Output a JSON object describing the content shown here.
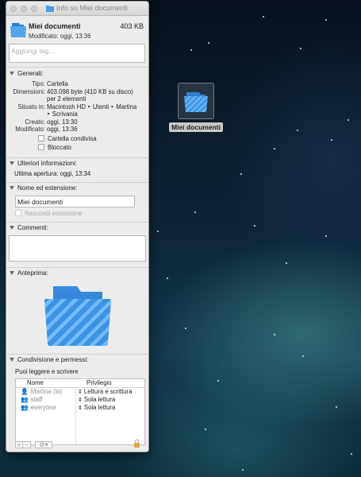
{
  "window": {
    "title": "Info su Miei documenti"
  },
  "header": {
    "name": "Miei documenti",
    "size": "403 KB",
    "modified": "Modificato: oggi, 13:36"
  },
  "tags": {
    "placeholder": "Aggiungi tag…"
  },
  "general": {
    "title": "Generali:",
    "rows": [
      {
        "key": "Tipo:",
        "value": "Cartella"
      },
      {
        "key": "Dimensioni:",
        "value": "403.098 byte (410 KB su disco)"
      },
      {
        "key": "",
        "value": "per 2 elementi"
      },
      {
        "key": "Situato in:",
        "value": "Macintosh HD ‣ Utenti ‣ Martina"
      },
      {
        "key": "",
        "value": "‣ Scrivania"
      },
      {
        "key": "Creato:",
        "value": "oggi, 13:30"
      },
      {
        "key": "Modificato:",
        "value": "oggi, 13:36"
      }
    ],
    "shared_label": "Cartella condivisa",
    "locked_label": "Bloccato"
  },
  "more_info": {
    "title": "Ulteriori informazioni:",
    "last_opened": "Ultima apertura: oggi, 13:34"
  },
  "name_ext": {
    "title": "Nome ed estensione:",
    "value": "Miei documenti",
    "hide_ext_label": "Nascondi estensione"
  },
  "comments": {
    "title": "Commenti:"
  },
  "preview": {
    "title": "Anteprima:"
  },
  "sharing": {
    "title": "Condivisione e permessi:",
    "status": "Puoi leggere e scrivere",
    "columns": [
      "Nome",
      "Privilegio"
    ],
    "rows": [
      {
        "name": "Martina (io)",
        "privilege": "Lettura e scrittura",
        "icon": "user-icon"
      },
      {
        "name": "staff",
        "privilege": "Sola lettura",
        "icon": "group-icon"
      },
      {
        "name": "everyone",
        "privilege": "Sola lettura",
        "icon": "group-icon"
      }
    ]
  },
  "desktop": {
    "icon_label": "Miei documenti"
  }
}
